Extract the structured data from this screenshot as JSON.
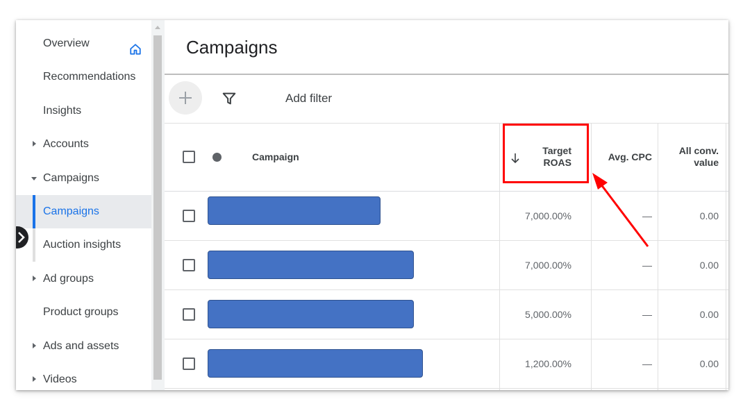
{
  "sidebar": {
    "items": [
      {
        "label": "Overview",
        "caret": "none",
        "state": "normal"
      },
      {
        "label": "Recommendations",
        "caret": "none",
        "state": "normal"
      },
      {
        "label": "Insights",
        "caret": "none",
        "state": "normal"
      },
      {
        "label": "Accounts",
        "caret": "right",
        "state": "normal"
      },
      {
        "label": "Campaigns",
        "caret": "down",
        "state": "normal"
      },
      {
        "label": "Campaigns",
        "caret": "none",
        "state": "active"
      },
      {
        "label": "Auction insights",
        "caret": "none",
        "state": "sub"
      },
      {
        "label": "Ad groups",
        "caret": "right",
        "state": "normal"
      },
      {
        "label": "Product groups",
        "caret": "none",
        "state": "normal"
      },
      {
        "label": "Ads and assets",
        "caret": "right",
        "state": "normal"
      },
      {
        "label": "Videos",
        "caret": "right",
        "state": "normal"
      }
    ],
    "overview_icon": "home-icon",
    "collapse_icon": "chevron-right-icon"
  },
  "main": {
    "title": "Campaigns",
    "toolbar": {
      "add_icon": "plus-icon",
      "filter_icon": "filter-icon",
      "add_filter_label": "Add filter"
    },
    "table": {
      "columns": {
        "campaign": "Campaign",
        "target_roas_line1": "Target",
        "target_roas_line2": "ROAS",
        "avg_cpc": "Avg. CPC",
        "all_conv_value_line1": "All conv.",
        "all_conv_value_line2": "value"
      },
      "sort_icon": "arrow-down-icon",
      "rows": [
        {
          "campaign": "",
          "target_roas": "7,000.00%",
          "avg_cpc": "—",
          "all_conv_value": "0.00"
        },
        {
          "campaign": "",
          "target_roas": "7,000.00%",
          "avg_cpc": "—",
          "all_conv_value": "0.00"
        },
        {
          "campaign": "",
          "target_roas": "5,000.00%",
          "avg_cpc": "—",
          "all_conv_value": "0.00"
        },
        {
          "campaign": "",
          "target_roas": "1,200.00%",
          "avg_cpc": "—",
          "all_conv_value": "0.00"
        }
      ]
    }
  },
  "colors": {
    "active_nav": "#1a73e8",
    "redaction": "#4472c4",
    "annotation": "#ff0000"
  }
}
